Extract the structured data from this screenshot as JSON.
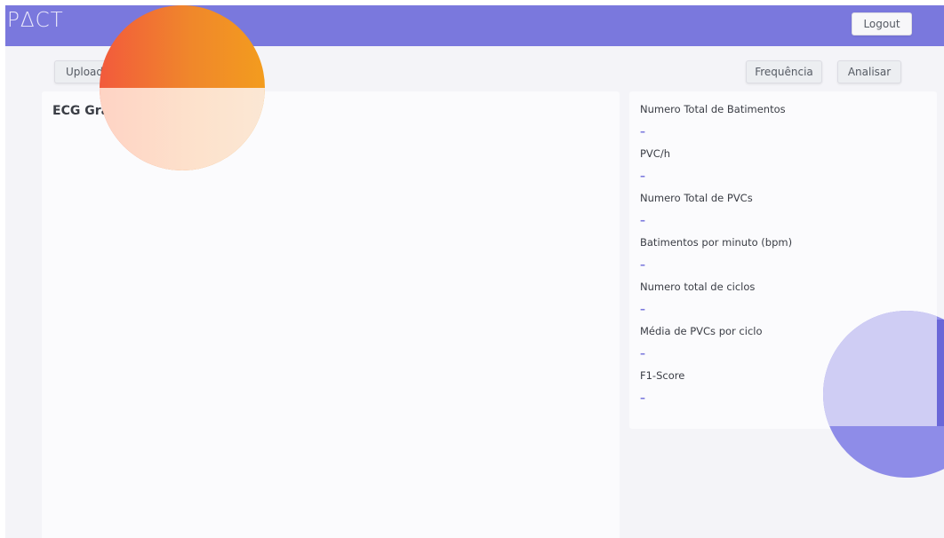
{
  "app": {
    "logo": "PΔCT"
  },
  "header": {
    "logout_label": "Logout"
  },
  "toolbar": {
    "upload_label": "Upload",
    "frequency_label": "Frequência",
    "analyze_label": "Analisar"
  },
  "graph": {
    "title": "ECG Graph"
  },
  "stats": {
    "items": [
      {
        "label": "Numero Total de Batimentos",
        "value": "–"
      },
      {
        "label": "PVC/h",
        "value": "–"
      },
      {
        "label": "Numero Total de PVCs",
        "value": "–"
      },
      {
        "label": "Batimentos por minuto (bpm)",
        "value": "–"
      },
      {
        "label": "Numero total de ciclos",
        "value": "–"
      },
      {
        "label": "Média de PVCs por ciclo",
        "value": "–"
      },
      {
        "label": "F1-Score",
        "value": "–"
      }
    ]
  },
  "colors": {
    "navbar": "#7a78dd",
    "accent": "#7a78dd",
    "background": "#f4f4f8",
    "panel": "#fbfbfd"
  }
}
